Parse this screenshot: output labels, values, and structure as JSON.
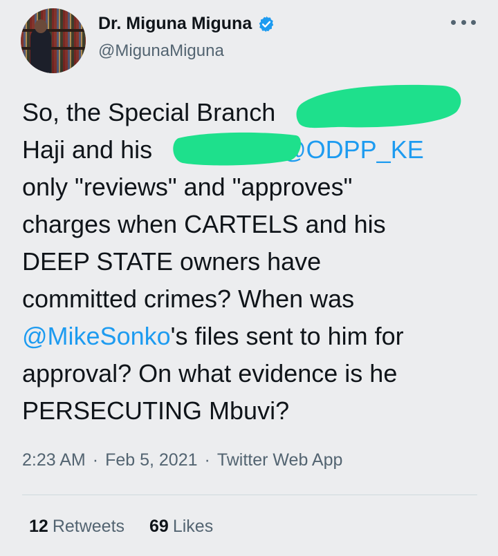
{
  "author": {
    "display_name": "Dr. Miguna Miguna",
    "handle": "@MigunaMiguna",
    "verified_icon": "verified-badge-icon",
    "verified_color": "#1d9bf0"
  },
  "tweet": {
    "lines": [
      {
        "pre": "So, the Special Branch",
        "mention": "",
        "post": ""
      },
      {
        "pre": "Haji and his ",
        "mention": "@ODPP_KE",
        "post": ""
      },
      {
        "pre": "only \"reviews\" and \"approves\"",
        "mention": "",
        "post": ""
      },
      {
        "pre": "charges when CARTELS and his",
        "mention": "",
        "post": ""
      },
      {
        "pre": "DEEP STATE owners have",
        "mention": "",
        "post": ""
      },
      {
        "pre": "committed crimes? When was",
        "mention": "",
        "post": ""
      },
      {
        "pre": "",
        "mention": "@MikeSonko",
        "post": "'s files sent to him for"
      },
      {
        "pre": "approval? On what evidence is he",
        "mention": "",
        "post": ""
      },
      {
        "pre": "PERSECUTING Mbuvi?",
        "mention": "",
        "post": ""
      }
    ],
    "redaction_color": "#1ee08c"
  },
  "meta": {
    "time": "2:23 AM",
    "separator": "·",
    "date": "Feb 5, 2021",
    "source": "Twitter Web App"
  },
  "stats": {
    "retweets_count": "12",
    "retweets_label": "Retweets",
    "likes_count": "69",
    "likes_label": "Likes"
  },
  "colors": {
    "background": "#ecedef",
    "text": "#0f1419",
    "secondary": "#536471",
    "link": "#1d9bf0"
  }
}
